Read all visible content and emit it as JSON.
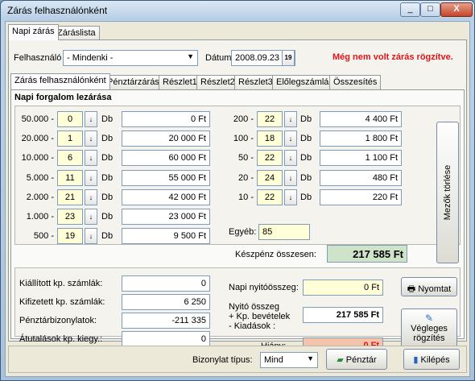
{
  "window": {
    "title": "Zárás felhasználónként",
    "controls": [
      "_",
      "□",
      "X"
    ]
  },
  "top_tabs": [
    "Napi zárás",
    "Záráslista"
  ],
  "filter": {
    "user_label": "Felhasználó",
    "user_value": "- Mindenki -",
    "date_label": "Dátum",
    "date_value": "2008.09.23",
    "calendar_icon": "19",
    "warning": "Még nem volt zárás rögzítve."
  },
  "inner_tabs": [
    "Zárás felhasználónként",
    "Pénztárzárás",
    "Részlet1",
    "Részlet2",
    "Részlet3",
    "Előlegszámlák",
    "Összesítés"
  ],
  "section_title": "Napi forgalom lezárása",
  "db_label": "Db",
  "left_denoms": [
    {
      "label": "50.000 -",
      "count": "0",
      "amount": "0 Ft"
    },
    {
      "label": "20.000 -",
      "count": "1",
      "amount": "20 000 Ft"
    },
    {
      "label": "10.000 -",
      "count": "6",
      "amount": "60 000 Ft"
    },
    {
      "label": "5.000 -",
      "count": "11",
      "amount": "55 000 Ft"
    },
    {
      "label": "2.000 -",
      "count": "21",
      "amount": "42 000 Ft"
    },
    {
      "label": "1.000 -",
      "count": "23",
      "amount": "23 000 Ft"
    },
    {
      "label": "500 -",
      "count": "19",
      "amount": "9 500 Ft"
    }
  ],
  "right_denoms": [
    {
      "label": "200 -",
      "count": "22",
      "amount": "4 400 Ft"
    },
    {
      "label": "100 -",
      "count": "18",
      "amount": "1 800 Ft"
    },
    {
      "label": "50 -",
      "count": "22",
      "amount": "1 100 Ft"
    },
    {
      "label": "20 -",
      "count": "24",
      "amount": "480 Ft"
    },
    {
      "label": "10 -",
      "count": "22",
      "amount": "220 Ft"
    }
  ],
  "egyeb": {
    "label": "Egyéb:",
    "value": "85"
  },
  "cash_total": {
    "label": "Készpénz összesen:",
    "value": "217 585 Ft"
  },
  "clear_button": "Mezők törlése",
  "summary_left": [
    {
      "label": "Kiállított kp. számlák:",
      "value": "0"
    },
    {
      "label": "Kifizetett kp. számlák:",
      "value": "6 250"
    },
    {
      "label": "Pénztárbizonylatok:",
      "value": "-211 335"
    },
    {
      "label": "Átutalások kp. kiegy.:",
      "value": "0"
    }
  ],
  "opening": {
    "label": "Napi nyitóösszeg:",
    "value": "0 Ft"
  },
  "nyito": {
    "label1": "Nyitó összeg",
    "label2": "+ Kp. bevételek",
    "label3": "- Kiadások :",
    "value": "217 585 Ft"
  },
  "hiany": {
    "label": "Hiány:",
    "value": "0 Ft"
  },
  "print_button": "Nyomtat",
  "finalize_button": {
    "line1": "Végleges",
    "line2": "rögzítés"
  },
  "footer": {
    "doc_type_label": "Bizonylat típus:",
    "doc_type_value": "Mind",
    "cash_button": "Pénztár",
    "exit_button": "Kilépés"
  }
}
